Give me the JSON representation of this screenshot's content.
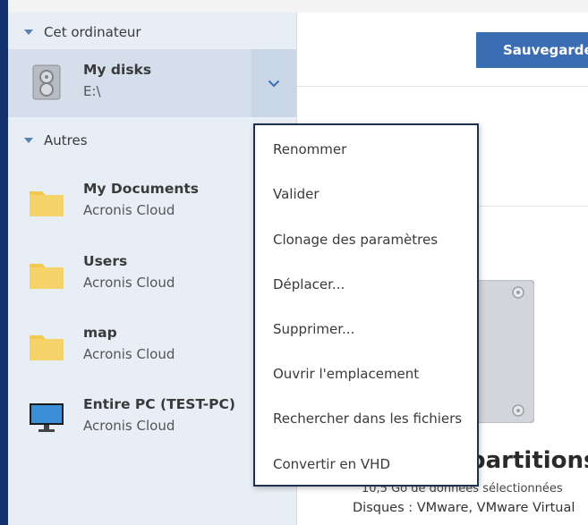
{
  "sidebar": {
    "section_computer": "Cet ordinateur",
    "section_others": "Autres",
    "items": [
      {
        "name": "My disks",
        "sub": "E:\\",
        "icon": "disk-icon"
      },
      {
        "name": "My Documents",
        "sub": "Acronis Cloud",
        "icon": "folder-icon"
      },
      {
        "name": "Users",
        "sub": "Acronis Cloud",
        "icon": "folder-icon"
      },
      {
        "name": "map",
        "sub": "Acronis Cloud",
        "icon": "folder-icon"
      },
      {
        "name": "Entire PC (TEST-PC)",
        "sub": "Acronis Cloud",
        "icon": "monitor-icon"
      }
    ]
  },
  "main": {
    "backup_button": "Sauvegarder",
    "partition_title": "partitions",
    "info_line1": "10,5 Go de données sélectionnées",
    "info_line2": "Disques : VMware, VMware Virtual"
  },
  "context_menu": {
    "items": [
      "Renommer",
      "Valider",
      "Clonage des paramètres",
      "Déplacer...",
      "Supprimer...",
      "Ouvrir l'emplacement",
      "Rechercher dans les fichiers",
      "Convertir en VHD"
    ]
  },
  "colors": {
    "accent": "#3b6db3",
    "sidebar_bg": "#e8eef5",
    "selected_bg": "#d5dfeb",
    "window_edge": "#12306b",
    "folder": "#f2c94c"
  }
}
